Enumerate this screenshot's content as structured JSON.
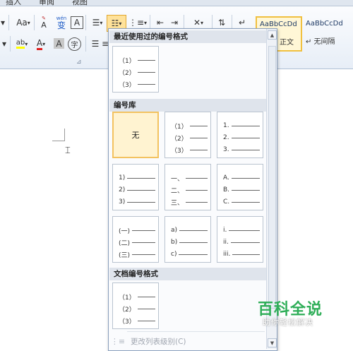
{
  "ribbon": {
    "tabs": [
      "插入",
      "审阅",
      "视图"
    ],
    "font_size_button": "Aa",
    "pinyin_glyph": "wén",
    "pinyin_char": "变",
    "border_char_button": "A",
    "highlight_label": "ab",
    "font_color_button": "A",
    "char_shading_button": "A",
    "enclose_char_button": "字",
    "styles": [
      {
        "preview": "AaBbCcDd",
        "name": "正文"
      },
      {
        "preview": "AaBbCcDd",
        "name": "↵ 无间隔"
      }
    ]
  },
  "dropdown": {
    "recent_header": "最近使用过的编号格式",
    "library_header": "编号库",
    "document_header": "文档编号格式",
    "recent_tiles": [
      {
        "items": [
          "（1）",
          "（2）",
          "（3）"
        ]
      }
    ],
    "library_tiles": [
      {
        "label": "无",
        "items": []
      },
      {
        "items": [
          "（1）",
          "（2）",
          "（3）"
        ]
      },
      {
        "items": [
          "1.",
          "2.",
          "3."
        ]
      },
      {
        "items": [
          "1)",
          "2)",
          "3)"
        ]
      },
      {
        "items": [
          "一、",
          "二、",
          "三、"
        ]
      },
      {
        "items": [
          "A.",
          "B.",
          "C."
        ]
      },
      {
        "items": [
          "(一)",
          "(二)",
          "(三)"
        ]
      },
      {
        "items": [
          "a)",
          "b)",
          "c)"
        ]
      },
      {
        "items": [
          "i.",
          "ii.",
          "iii."
        ]
      }
    ],
    "document_tiles": [
      {
        "items": [
          "（1）",
          "（2）",
          "（3）"
        ]
      }
    ],
    "change_level_item": "更改列表级别(C)"
  },
  "watermark": {
    "title": "百科全说",
    "subtitle": "助你轻松解决"
  }
}
